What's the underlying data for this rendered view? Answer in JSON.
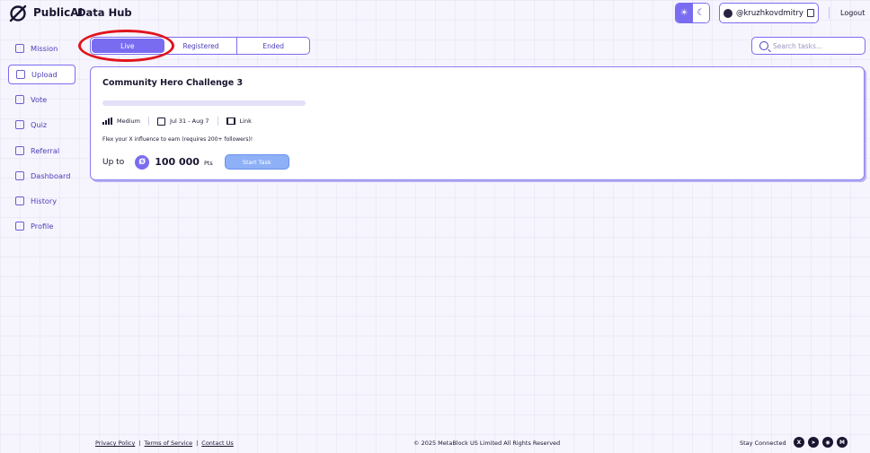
{
  "header": {
    "brand": "PublicAI",
    "subtitle": "Data Hub",
    "username": "@kruzhkovdmitry",
    "logout": "Logout",
    "theme": {
      "light_icon": "☀",
      "dark_icon": "☾",
      "active": "light"
    }
  },
  "sidebar": {
    "items": [
      {
        "label": "Mission",
        "icon": "mission-icon",
        "active": false
      },
      {
        "label": "Upload",
        "icon": "upload-icon",
        "active": true
      },
      {
        "label": "Vote",
        "icon": "vote-icon",
        "active": false
      },
      {
        "label": "Quiz",
        "icon": "quiz-icon",
        "active": false
      },
      {
        "label": "Referral",
        "icon": "referral-icon",
        "active": false
      },
      {
        "label": "Dashboard",
        "icon": "dashboard-icon",
        "active": false
      },
      {
        "label": "History",
        "icon": "history-icon",
        "active": false
      },
      {
        "label": "Profile",
        "icon": "profile-icon",
        "active": false
      }
    ]
  },
  "tabs": [
    {
      "label": "Live",
      "active": true
    },
    {
      "label": "Registered",
      "active": false
    },
    {
      "label": "Ended",
      "active": false
    }
  ],
  "search": {
    "placeholder": "Search tasks..."
  },
  "task": {
    "title": "Community Hero Challenge 3",
    "progress": 0,
    "difficulty": "Medium",
    "dates": "Jul 31 - Aug 7",
    "type": "Link",
    "description": "Flex your X influence to earn (requires 200+ followers)!",
    "reward_prefix": "Up to",
    "reward_points": "100 000",
    "reward_unit": "Pts",
    "button": "Start Task"
  },
  "footer": {
    "privacy": "Privacy Policy",
    "terms": "Terms of Service",
    "contact": "Contact Us",
    "separator": "|",
    "copyright": "© 2025 MetaBlock US Limited All Rights Reserved",
    "stay_connected": "Stay Connected",
    "socials": [
      {
        "name": "x-icon",
        "glyph": "X"
      },
      {
        "name": "telegram-icon",
        "glyph": "➤"
      },
      {
        "name": "discord-icon",
        "glyph": "◉"
      },
      {
        "name": "medium-icon",
        "glyph": "M"
      }
    ]
  },
  "colors": {
    "accent": "#7a6cf0",
    "button": "#8eb0f7",
    "highlight_ring": "#e0141c"
  }
}
